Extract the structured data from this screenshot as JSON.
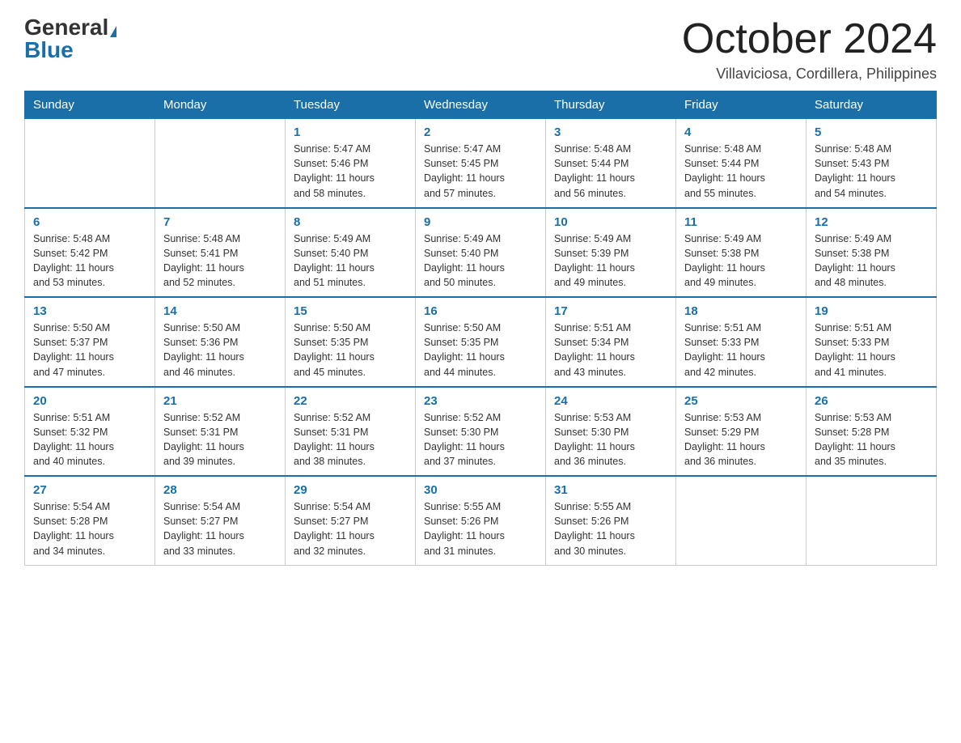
{
  "header": {
    "logo_general": "General",
    "logo_blue": "Blue",
    "month_title": "October 2024",
    "location": "Villaviciosa, Cordillera, Philippines"
  },
  "weekdays": [
    "Sunday",
    "Monday",
    "Tuesday",
    "Wednesday",
    "Thursday",
    "Friday",
    "Saturday"
  ],
  "weeks": [
    [
      {
        "day": "",
        "info": ""
      },
      {
        "day": "",
        "info": ""
      },
      {
        "day": "1",
        "info": "Sunrise: 5:47 AM\nSunset: 5:46 PM\nDaylight: 11 hours\nand 58 minutes."
      },
      {
        "day": "2",
        "info": "Sunrise: 5:47 AM\nSunset: 5:45 PM\nDaylight: 11 hours\nand 57 minutes."
      },
      {
        "day": "3",
        "info": "Sunrise: 5:48 AM\nSunset: 5:44 PM\nDaylight: 11 hours\nand 56 minutes."
      },
      {
        "day": "4",
        "info": "Sunrise: 5:48 AM\nSunset: 5:44 PM\nDaylight: 11 hours\nand 55 minutes."
      },
      {
        "day": "5",
        "info": "Sunrise: 5:48 AM\nSunset: 5:43 PM\nDaylight: 11 hours\nand 54 minutes."
      }
    ],
    [
      {
        "day": "6",
        "info": "Sunrise: 5:48 AM\nSunset: 5:42 PM\nDaylight: 11 hours\nand 53 minutes."
      },
      {
        "day": "7",
        "info": "Sunrise: 5:48 AM\nSunset: 5:41 PM\nDaylight: 11 hours\nand 52 minutes."
      },
      {
        "day": "8",
        "info": "Sunrise: 5:49 AM\nSunset: 5:40 PM\nDaylight: 11 hours\nand 51 minutes."
      },
      {
        "day": "9",
        "info": "Sunrise: 5:49 AM\nSunset: 5:40 PM\nDaylight: 11 hours\nand 50 minutes."
      },
      {
        "day": "10",
        "info": "Sunrise: 5:49 AM\nSunset: 5:39 PM\nDaylight: 11 hours\nand 49 minutes."
      },
      {
        "day": "11",
        "info": "Sunrise: 5:49 AM\nSunset: 5:38 PM\nDaylight: 11 hours\nand 49 minutes."
      },
      {
        "day": "12",
        "info": "Sunrise: 5:49 AM\nSunset: 5:38 PM\nDaylight: 11 hours\nand 48 minutes."
      }
    ],
    [
      {
        "day": "13",
        "info": "Sunrise: 5:50 AM\nSunset: 5:37 PM\nDaylight: 11 hours\nand 47 minutes."
      },
      {
        "day": "14",
        "info": "Sunrise: 5:50 AM\nSunset: 5:36 PM\nDaylight: 11 hours\nand 46 minutes."
      },
      {
        "day": "15",
        "info": "Sunrise: 5:50 AM\nSunset: 5:35 PM\nDaylight: 11 hours\nand 45 minutes."
      },
      {
        "day": "16",
        "info": "Sunrise: 5:50 AM\nSunset: 5:35 PM\nDaylight: 11 hours\nand 44 minutes."
      },
      {
        "day": "17",
        "info": "Sunrise: 5:51 AM\nSunset: 5:34 PM\nDaylight: 11 hours\nand 43 minutes."
      },
      {
        "day": "18",
        "info": "Sunrise: 5:51 AM\nSunset: 5:33 PM\nDaylight: 11 hours\nand 42 minutes."
      },
      {
        "day": "19",
        "info": "Sunrise: 5:51 AM\nSunset: 5:33 PM\nDaylight: 11 hours\nand 41 minutes."
      }
    ],
    [
      {
        "day": "20",
        "info": "Sunrise: 5:51 AM\nSunset: 5:32 PM\nDaylight: 11 hours\nand 40 minutes."
      },
      {
        "day": "21",
        "info": "Sunrise: 5:52 AM\nSunset: 5:31 PM\nDaylight: 11 hours\nand 39 minutes."
      },
      {
        "day": "22",
        "info": "Sunrise: 5:52 AM\nSunset: 5:31 PM\nDaylight: 11 hours\nand 38 minutes."
      },
      {
        "day": "23",
        "info": "Sunrise: 5:52 AM\nSunset: 5:30 PM\nDaylight: 11 hours\nand 37 minutes."
      },
      {
        "day": "24",
        "info": "Sunrise: 5:53 AM\nSunset: 5:30 PM\nDaylight: 11 hours\nand 36 minutes."
      },
      {
        "day": "25",
        "info": "Sunrise: 5:53 AM\nSunset: 5:29 PM\nDaylight: 11 hours\nand 36 minutes."
      },
      {
        "day": "26",
        "info": "Sunrise: 5:53 AM\nSunset: 5:28 PM\nDaylight: 11 hours\nand 35 minutes."
      }
    ],
    [
      {
        "day": "27",
        "info": "Sunrise: 5:54 AM\nSunset: 5:28 PM\nDaylight: 11 hours\nand 34 minutes."
      },
      {
        "day": "28",
        "info": "Sunrise: 5:54 AM\nSunset: 5:27 PM\nDaylight: 11 hours\nand 33 minutes."
      },
      {
        "day": "29",
        "info": "Sunrise: 5:54 AM\nSunset: 5:27 PM\nDaylight: 11 hours\nand 32 minutes."
      },
      {
        "day": "30",
        "info": "Sunrise: 5:55 AM\nSunset: 5:26 PM\nDaylight: 11 hours\nand 31 minutes."
      },
      {
        "day": "31",
        "info": "Sunrise: 5:55 AM\nSunset: 5:26 PM\nDaylight: 11 hours\nand 30 minutes."
      },
      {
        "day": "",
        "info": ""
      },
      {
        "day": "",
        "info": ""
      }
    ]
  ]
}
